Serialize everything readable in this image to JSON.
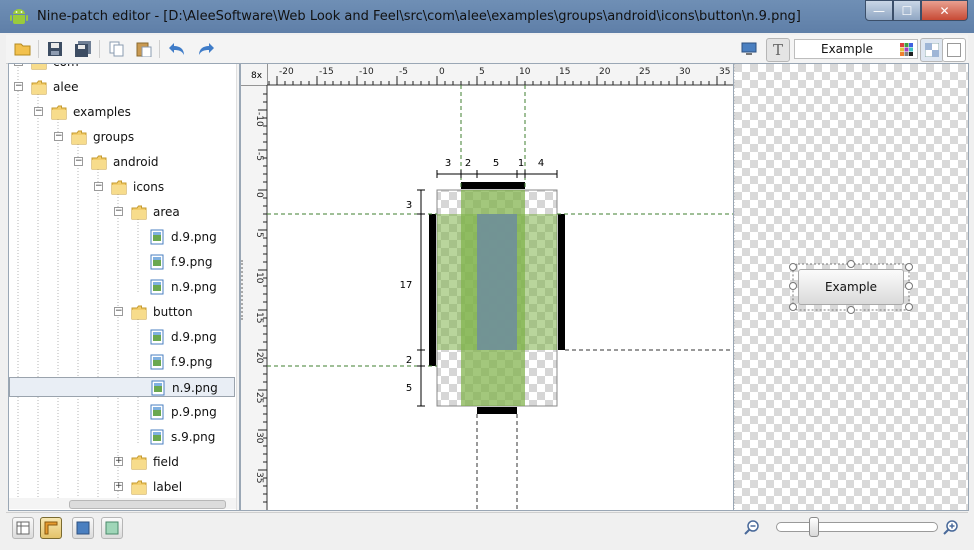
{
  "window": {
    "title": "Nine-patch editor - [D:\\AleeSoftware\\Web Look and Feel\\src\\com\\alee\\examples\\groups\\android\\icons\\button\\n.9.png]",
    "minimize": "—",
    "maximize": "☐",
    "close": "✕"
  },
  "toolbar": {
    "buttons": [
      "folder-open-icon",
      "save-icon",
      "save-all-icon",
      "copy-icon",
      "paste-icon",
      "undo-icon",
      "redo-icon"
    ],
    "preview_text": "Example"
  },
  "tree": {
    "items": [
      {
        "label": "com",
        "kind": "folder",
        "level": 0,
        "expanded": true
      },
      {
        "label": "alee",
        "kind": "folder",
        "level": 0,
        "expanded": true
      },
      {
        "label": "examples",
        "kind": "folder",
        "level": 1,
        "expanded": true
      },
      {
        "label": "groups",
        "kind": "folder",
        "level": 2,
        "expanded": true
      },
      {
        "label": "android",
        "kind": "folder",
        "level": 3,
        "expanded": true
      },
      {
        "label": "icons",
        "kind": "folder",
        "level": 4,
        "expanded": true
      },
      {
        "label": "area",
        "kind": "folder",
        "level": 5,
        "expanded": true
      },
      {
        "label": "d.9.png",
        "kind": "file",
        "level": 6
      },
      {
        "label": "f.9.png",
        "kind": "file",
        "level": 6
      },
      {
        "label": "n.9.png",
        "kind": "file",
        "level": 6
      },
      {
        "label": "button",
        "kind": "folder",
        "level": 5,
        "expanded": true
      },
      {
        "label": "d.9.png",
        "kind": "file",
        "level": 6
      },
      {
        "label": "f.9.png",
        "kind": "file",
        "level": 6
      },
      {
        "label": "n.9.png",
        "kind": "file",
        "level": 6,
        "selected": true
      },
      {
        "label": "p.9.png",
        "kind": "file",
        "level": 6
      },
      {
        "label": "s.9.png",
        "kind": "file",
        "level": 6
      },
      {
        "label": "field",
        "kind": "folder",
        "level": 5,
        "expanded": false
      },
      {
        "label": "label",
        "kind": "folder",
        "level": 5,
        "expanded": false
      }
    ]
  },
  "editor": {
    "zoom_label": "8x",
    "top_ruler_labels": [
      "-20",
      "-15",
      "-10",
      "-5",
      "0",
      "5",
      "10",
      "15",
      "20",
      "25",
      "30",
      "35"
    ],
    "left_ruler_labels": [
      "-10",
      "-5",
      "0",
      "5",
      "10",
      "15",
      "20",
      "25",
      "30",
      "35"
    ],
    "col_measures": [
      "3",
      "2",
      "5",
      "1",
      "4"
    ],
    "row_measures": [
      "3",
      "17",
      "2",
      "5"
    ]
  },
  "preview": {
    "button_label": "Example"
  },
  "statusbar": {
    "left_buttons": [
      "nine-patch-guides-icon",
      "ruler-icon",
      "solid-background-icon",
      "color-background-icon"
    ],
    "zoom_out": "zoom-out-icon",
    "zoom_in": "zoom-in-icon",
    "zoom_level": 0.22
  },
  "colors": {
    "guide": "#3f7f2f",
    "stretch_fill": "#7fb24a",
    "content_fill": "#6f8f9a",
    "patch_mark": "#000000"
  }
}
